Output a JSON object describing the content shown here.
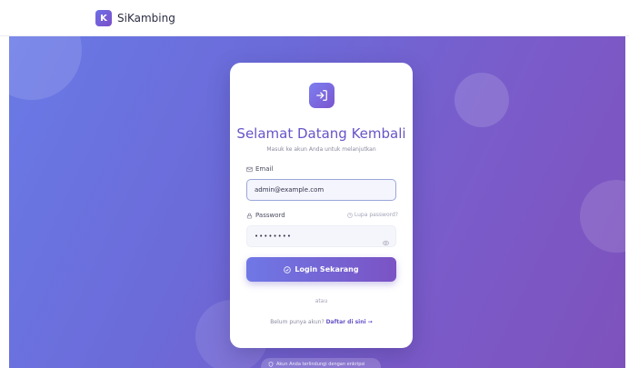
{
  "navbar": {
    "logo_letter": "K",
    "brand_name": "SiKambing"
  },
  "login": {
    "title": "Selamat Datang Kembali",
    "subtitle": "Masuk ke akun Anda untuk melanjutkan",
    "email_label": "Email",
    "email_value": "admin@example.com",
    "password_label": "Password",
    "forgot_label": "Lupa password?",
    "password_value": "••••••••",
    "submit_label": "Login Sekarang",
    "divider": "atau",
    "register_prompt": "Belum punya akun?",
    "register_link": "Daftar di sini →"
  },
  "notice": {
    "text": "Akun Anda terlindungi dengan enkripsi"
  },
  "icons": {
    "login": "login-arrow-icon",
    "email": "mail-icon",
    "password": "lock-icon",
    "forgot": "help-circle-icon",
    "eye": "eye-icon",
    "submit": "check-circle-icon",
    "notice": "shield-icon"
  },
  "colors": {
    "accent": "#6655c8",
    "gradient_start": "#6a7ae6",
    "gradient_end": "#7e52bc"
  }
}
